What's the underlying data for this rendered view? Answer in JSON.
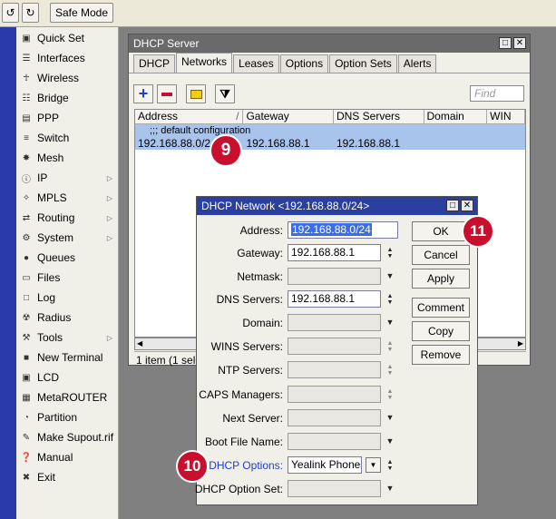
{
  "toolbar": {
    "undo_icon": "undo-icon",
    "redo_icon": "redo-icon",
    "safe_mode": "Safe Mode"
  },
  "menu": [
    {
      "label": "Quick Set",
      "icon": "quickset-icon",
      "arrow": false
    },
    {
      "label": "Interfaces",
      "icon": "interfaces-icon",
      "arrow": false
    },
    {
      "label": "Wireless",
      "icon": "wireless-icon",
      "arrow": false
    },
    {
      "label": "Bridge",
      "icon": "bridge-icon",
      "arrow": false
    },
    {
      "label": "PPP",
      "icon": "ppp-icon",
      "arrow": false
    },
    {
      "label": "Switch",
      "icon": "switch-icon",
      "arrow": false
    },
    {
      "label": "Mesh",
      "icon": "mesh-icon",
      "arrow": false
    },
    {
      "label": "IP",
      "icon": "ip-icon",
      "arrow": true
    },
    {
      "label": "MPLS",
      "icon": "mpls-icon",
      "arrow": true
    },
    {
      "label": "Routing",
      "icon": "routing-icon",
      "arrow": true
    },
    {
      "label": "System",
      "icon": "system-icon",
      "arrow": true
    },
    {
      "label": "Queues",
      "icon": "queues-icon",
      "arrow": false
    },
    {
      "label": "Files",
      "icon": "files-icon",
      "arrow": false
    },
    {
      "label": "Log",
      "icon": "log-icon",
      "arrow": false
    },
    {
      "label": "Radius",
      "icon": "radius-icon",
      "arrow": false
    },
    {
      "label": "Tools",
      "icon": "tools-icon",
      "arrow": true
    },
    {
      "label": "New Terminal",
      "icon": "terminal-icon",
      "arrow": false
    },
    {
      "label": "LCD",
      "icon": "lcd-icon",
      "arrow": false
    },
    {
      "label": "MetaROUTER",
      "icon": "metarouter-icon",
      "arrow": false
    },
    {
      "label": "Partition",
      "icon": "partition-icon",
      "arrow": false
    },
    {
      "label": "Make Supout.rif",
      "icon": "supout-icon",
      "arrow": false
    },
    {
      "label": "Manual",
      "icon": "manual-icon",
      "arrow": false
    },
    {
      "label": "Exit",
      "icon": "exit-icon",
      "arrow": false
    }
  ],
  "dhcp_server": {
    "title": "DHCP Server",
    "tabs": [
      "DHCP",
      "Networks",
      "Leases",
      "Options",
      "Option Sets",
      "Alerts"
    ],
    "active_tab": "Networks",
    "find_placeholder": "Find",
    "columns": [
      "Address",
      "Gateway",
      "DNS Servers",
      "Domain",
      "WIN"
    ],
    "sort_indicator": "/",
    "comment": ";;; default configuration",
    "row": {
      "address": "192.168.88.0/24",
      "gateway": "192.168.88.1",
      "dns": "192.168.88.1",
      "domain": "",
      "wins": ""
    },
    "status": "1 item (1 selec"
  },
  "dialog": {
    "title": "DHCP Network <192.168.88.0/24>",
    "fields": {
      "address": {
        "label": "Address:",
        "value": "192.168.88.0/24"
      },
      "gateway": {
        "label": "Gateway:",
        "value": "192.168.88.1"
      },
      "netmask": {
        "label": "Netmask:",
        "value": ""
      },
      "dns": {
        "label": "DNS Servers:",
        "value": "192.168.88.1"
      },
      "domain": {
        "label": "Domain:",
        "value": ""
      },
      "wins": {
        "label": "WINS Servers:",
        "value": ""
      },
      "ntp": {
        "label": "NTP Servers:",
        "value": ""
      },
      "caps": {
        "label": "CAPS Managers:",
        "value": ""
      },
      "next_server": {
        "label": "Next Server:",
        "value": ""
      },
      "boot_file": {
        "label": "Boot File Name:",
        "value": ""
      },
      "dhcp_options": {
        "label": "DHCP Options:",
        "value": "Yealink Phones"
      },
      "dhcp_option_set": {
        "label": "DHCP Option Set:",
        "value": ""
      }
    },
    "buttons": {
      "ok": "OK",
      "cancel": "Cancel",
      "apply": "Apply",
      "comment": "Comment",
      "copy": "Copy",
      "remove": "Remove"
    }
  },
  "badges": {
    "b9": "9",
    "b10": "10",
    "b11": "11"
  },
  "colors": {
    "accent": "#2b3fa0",
    "badge": "#c8102e",
    "selected_row": "#a8c4ec",
    "link": "#1f3fcf"
  }
}
